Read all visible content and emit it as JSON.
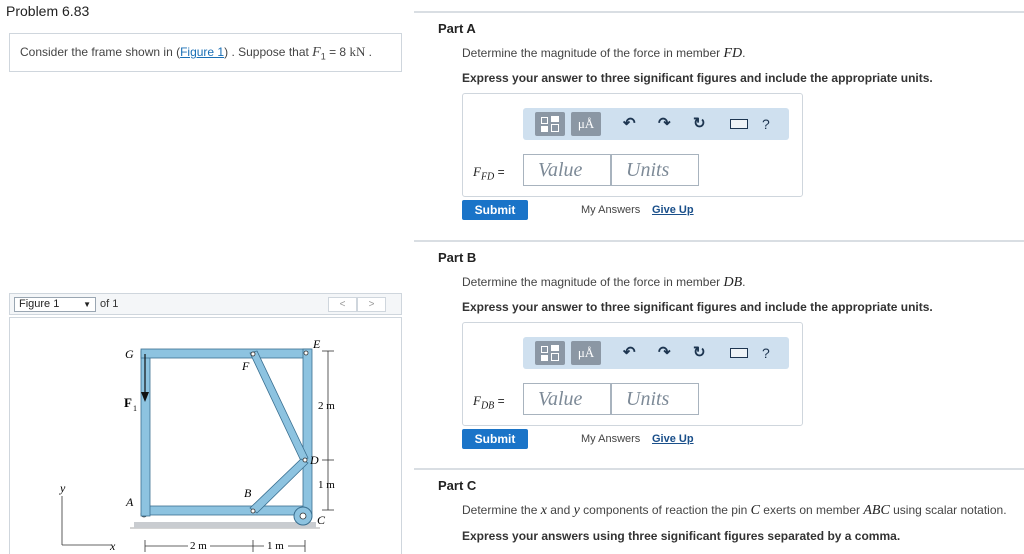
{
  "problem_title": "Problem 6.83",
  "intro": {
    "text_before": "Consider the frame shown in (",
    "figure_link": "Figure 1",
    "text_mid": ") . Suppose that ",
    "var": "F",
    "var_sub": "1",
    "text_eq": " = 8 ",
    "unit": "kN",
    "text_end": " ."
  },
  "figure_nav": {
    "selected": "Figure 1",
    "of_text": "of 1",
    "prev": "<",
    "next": ">"
  },
  "figure": {
    "labels": {
      "G": "G",
      "E": "E",
      "F": "F",
      "F1": "F",
      "F1_sub": "1",
      "D": "D",
      "A": "A",
      "B": "B",
      "C": "C",
      "x": "x",
      "y": "y",
      "dim_2m_vert": "2 m",
      "dim_1m_vert": "1 m",
      "dim_2m_horiz": "2 m",
      "dim_1m_horiz": "1 m"
    }
  },
  "parts": [
    {
      "title": "Part A",
      "question": "Determine the magnitude of the force in member ",
      "member": "FD",
      "question_end": ".",
      "instruction": "Express your answer to three significant figures and include the appropriate units.",
      "label_var": "F",
      "label_sub": "FD",
      "label_eq": " =",
      "value_placeholder": "Value",
      "units_placeholder": "Units",
      "submit": "Submit",
      "my_answers": "My Answers",
      "give_up": "Give Up"
    },
    {
      "title": "Part B",
      "question": "Determine the magnitude of the force in member ",
      "member": "DB",
      "question_end": ".",
      "instruction": "Express your answer to three significant figures and include the appropriate units.",
      "label_var": "F",
      "label_sub": "DB",
      "label_eq": " =",
      "value_placeholder": "Value",
      "units_placeholder": "Units",
      "submit": "Submit",
      "my_answers": "My Answers",
      "give_up": "Give Up"
    },
    {
      "title": "Part C",
      "question_a": "Determine the ",
      "var_x": "x",
      "question_b": " and ",
      "var_y": "y",
      "question_c": " components of reaction the pin ",
      "var_C": "C",
      "question_d": " exerts on member ",
      "var_ABC": "ABC",
      "question_e": " using scalar notation.",
      "instruction": "Express your answers using three significant figures separated by a comma."
    }
  ],
  "toolbar": {
    "mu_label": "μÅ",
    "undo": "↶",
    "redo": "↷",
    "reset": "↻",
    "help": "?",
    "icons": [
      "templates-icon",
      "units-icon",
      "undo-icon",
      "redo-icon",
      "reset-icon",
      "keyboard-icon",
      "help-icon"
    ]
  },
  "colors": {
    "accent": "#1a74c8",
    "toolbar_bg": "#cfe0ef",
    "frame_member": "#8dc3e0",
    "link": "#1a6fb5"
  }
}
